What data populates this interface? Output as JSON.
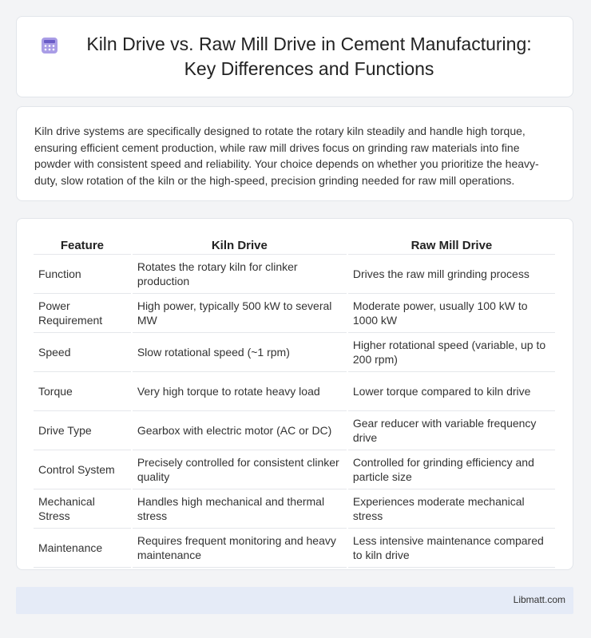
{
  "header": {
    "icon": "calculator-icon",
    "title": "Kiln Drive vs. Raw Mill Drive in Cement Manufacturing: Key Differences and Functions"
  },
  "intro": "Kiln drive systems are specifically designed to rotate the rotary kiln steadily and handle high torque, ensuring efficient cement production, while raw mill drives focus on grinding raw materials into fine powder with consistent speed and reliability. Your choice depends on whether you prioritize the heavy-duty, slow rotation of the kiln or the high-speed, precision grinding needed for raw mill operations.",
  "table": {
    "headers": [
      "Feature",
      "Kiln Drive",
      "Raw Mill Drive"
    ],
    "rows": [
      [
        "Function",
        "Rotates the rotary kiln for clinker production",
        "Drives the raw mill grinding process"
      ],
      [
        "Power Requirement",
        "High power, typically 500 kW to several MW",
        "Moderate power, usually 100 kW to 1000 kW"
      ],
      [
        "Speed",
        "Slow rotational speed (~1 rpm)",
        "Higher rotational speed (variable, up to 200 rpm)"
      ],
      [
        "Torque",
        "Very high torque to rotate heavy load",
        "Lower torque compared to kiln drive"
      ],
      [
        "Drive Type",
        "Gearbox with electric motor (AC or DC)",
        "Gear reducer with variable frequency drive"
      ],
      [
        "Control System",
        "Precisely controlled for consistent clinker quality",
        "Controlled for grinding efficiency and particle size"
      ],
      [
        "Mechanical Stress",
        "Handles high mechanical and thermal stress",
        "Experiences moderate mechanical stress"
      ],
      [
        "Maintenance",
        "Requires frequent monitoring and heavy maintenance",
        "Less intensive maintenance compared to kiln drive"
      ]
    ]
  },
  "footer": {
    "site": "Libmatt.com"
  },
  "colors": {
    "background": "#f3f4f6",
    "footer": "#e5ebf7",
    "icon": "#8b7fd6"
  }
}
